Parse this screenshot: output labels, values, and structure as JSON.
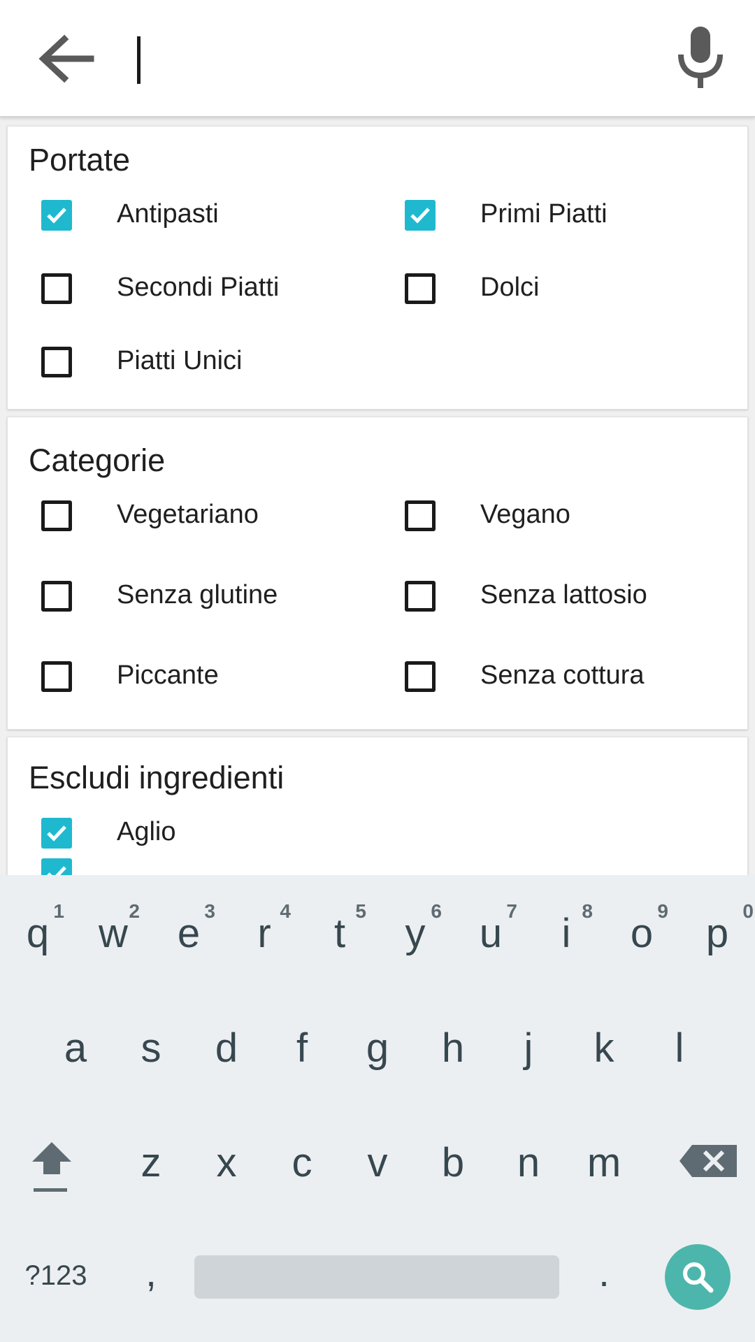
{
  "search": {
    "value": "",
    "placeholder": ""
  },
  "sections": [
    {
      "title": "Portate",
      "options": [
        {
          "label": "Antipasti",
          "checked": true
        },
        {
          "label": "Primi Piatti",
          "checked": true
        },
        {
          "label": "Secondi Piatti",
          "checked": false
        },
        {
          "label": "Dolci",
          "checked": false
        },
        {
          "label": "Piatti Unici",
          "checked": false
        }
      ]
    },
    {
      "title": "Categorie",
      "options": [
        {
          "label": "Vegetariano",
          "checked": false
        },
        {
          "label": "Vegano",
          "checked": false
        },
        {
          "label": "Senza glutine",
          "checked": false
        },
        {
          "label": "Senza lattosio",
          "checked": false
        },
        {
          "label": "Piccante",
          "checked": false
        },
        {
          "label": "Senza cottura",
          "checked": false
        }
      ]
    },
    {
      "title": "Escludi ingredienti",
      "options": [
        {
          "label": "Aglio",
          "checked": true
        },
        {
          "label": "",
          "checked": true
        }
      ]
    }
  ],
  "keyboard": {
    "row1": [
      {
        "ch": "q",
        "hint": "1"
      },
      {
        "ch": "w",
        "hint": "2"
      },
      {
        "ch": "e",
        "hint": "3"
      },
      {
        "ch": "r",
        "hint": "4"
      },
      {
        "ch": "t",
        "hint": "5"
      },
      {
        "ch": "y",
        "hint": "6"
      },
      {
        "ch": "u",
        "hint": "7"
      },
      {
        "ch": "i",
        "hint": "8"
      },
      {
        "ch": "o",
        "hint": "9"
      },
      {
        "ch": "p",
        "hint": "0"
      }
    ],
    "row2": [
      "a",
      "s",
      "d",
      "f",
      "g",
      "h",
      "j",
      "k",
      "l"
    ],
    "row3": [
      "z",
      "x",
      "c",
      "v",
      "b",
      "n",
      "m"
    ],
    "symbols_label": "?123",
    "comma": ",",
    "period": "."
  },
  "colors": {
    "accent": "#1fb9cf",
    "keyboard_bg": "#eceff1",
    "key_text": "#37474f",
    "search_key": "#4db6ac"
  },
  "icons": {
    "back": "arrow-left-icon",
    "mic": "microphone-icon",
    "shift": "shift-icon",
    "backspace": "backspace-icon",
    "search": "search-icon"
  }
}
